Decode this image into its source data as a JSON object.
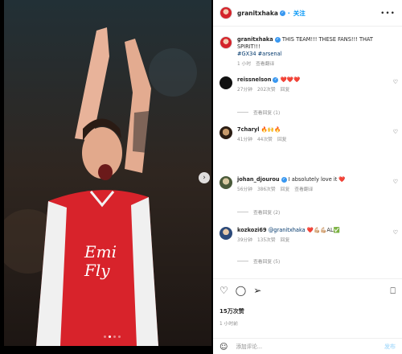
{
  "post": {
    "author": "granitxhaka",
    "follow_label": "关注",
    "more_label": "•••",
    "next_label": "›",
    "caption": "THIS TEAM!!! THESE FANS!!! THAT SPIRIT!!!",
    "hashtags": "#GX34 #arsenal",
    "caption_time": "1 小时",
    "caption_translate": "查看翻译"
  },
  "comments": [
    {
      "user": "reissnelson",
      "text": "❤️❤️❤️",
      "time": "27分钟",
      "likes": "202次赞",
      "reply": "回复",
      "view_replies": "查看回复 (1)"
    },
    {
      "user": "7charyl",
      "text": "🔥🙌🔥",
      "time": "41分钟",
      "likes": "44次赞",
      "reply": "回复",
      "view_replies": ""
    },
    {
      "user": "johan_djourou",
      "text": "I absolutely love it ❤️",
      "time": "56分钟",
      "likes": "386次赞",
      "reply": "回复",
      "translate": "查看翻译",
      "view_replies": "查看回复 (2)"
    },
    {
      "user": "kozkozi69",
      "mention": "@granitxhaka",
      "text": " ❤️💪🏼💪🏼AL✅",
      "time": "39分钟",
      "likes": "135次赞",
      "reply": "回复",
      "view_replies": "查看回复 (5)"
    }
  ],
  "actions": {
    "like_icon": "heart-icon",
    "comment_icon": "comment-icon",
    "share_icon": "share-icon",
    "save_icon": "bookmark-icon",
    "likes_count": "15万次赞",
    "date": "1 小时前"
  },
  "add_comment": {
    "placeholder": "添加评论...",
    "post_label": "发布"
  },
  "carousel": {
    "slide_count": 4,
    "active_index": 1
  },
  "colors": {
    "accent": "#0095f6",
    "verified": "#3897f0",
    "text": "#262626",
    "meta": "#8e8e8e"
  }
}
